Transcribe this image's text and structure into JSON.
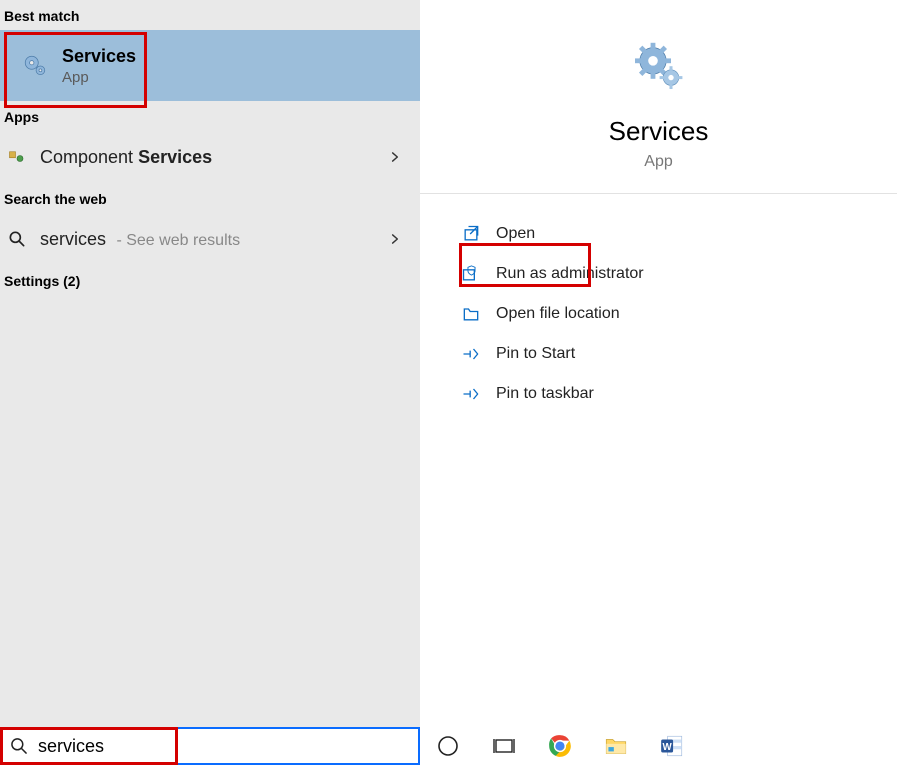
{
  "left": {
    "best_match_header": "Best match",
    "best_match": {
      "title": "Services",
      "subtitle": "App"
    },
    "apps_header": "Apps",
    "apps": [
      {
        "prefix": "Component ",
        "bold": "Services"
      }
    ],
    "web_header": "Search the web",
    "web": {
      "query": "services",
      "hint": " - See web results"
    },
    "settings_header": "Settings (2)"
  },
  "right": {
    "title": "Services",
    "subtitle": "App",
    "actions": [
      {
        "key": "open",
        "label": "Open"
      },
      {
        "key": "run-admin",
        "label": "Run as administrator"
      },
      {
        "key": "file-location",
        "label": "Open file location"
      },
      {
        "key": "pin-start",
        "label": "Pin to Start"
      },
      {
        "key": "pin-taskbar",
        "label": "Pin to taskbar"
      }
    ]
  },
  "search": {
    "value": "services"
  },
  "taskbar": {
    "items": [
      "cortana",
      "task-view",
      "chrome",
      "file-explorer",
      "word"
    ]
  }
}
